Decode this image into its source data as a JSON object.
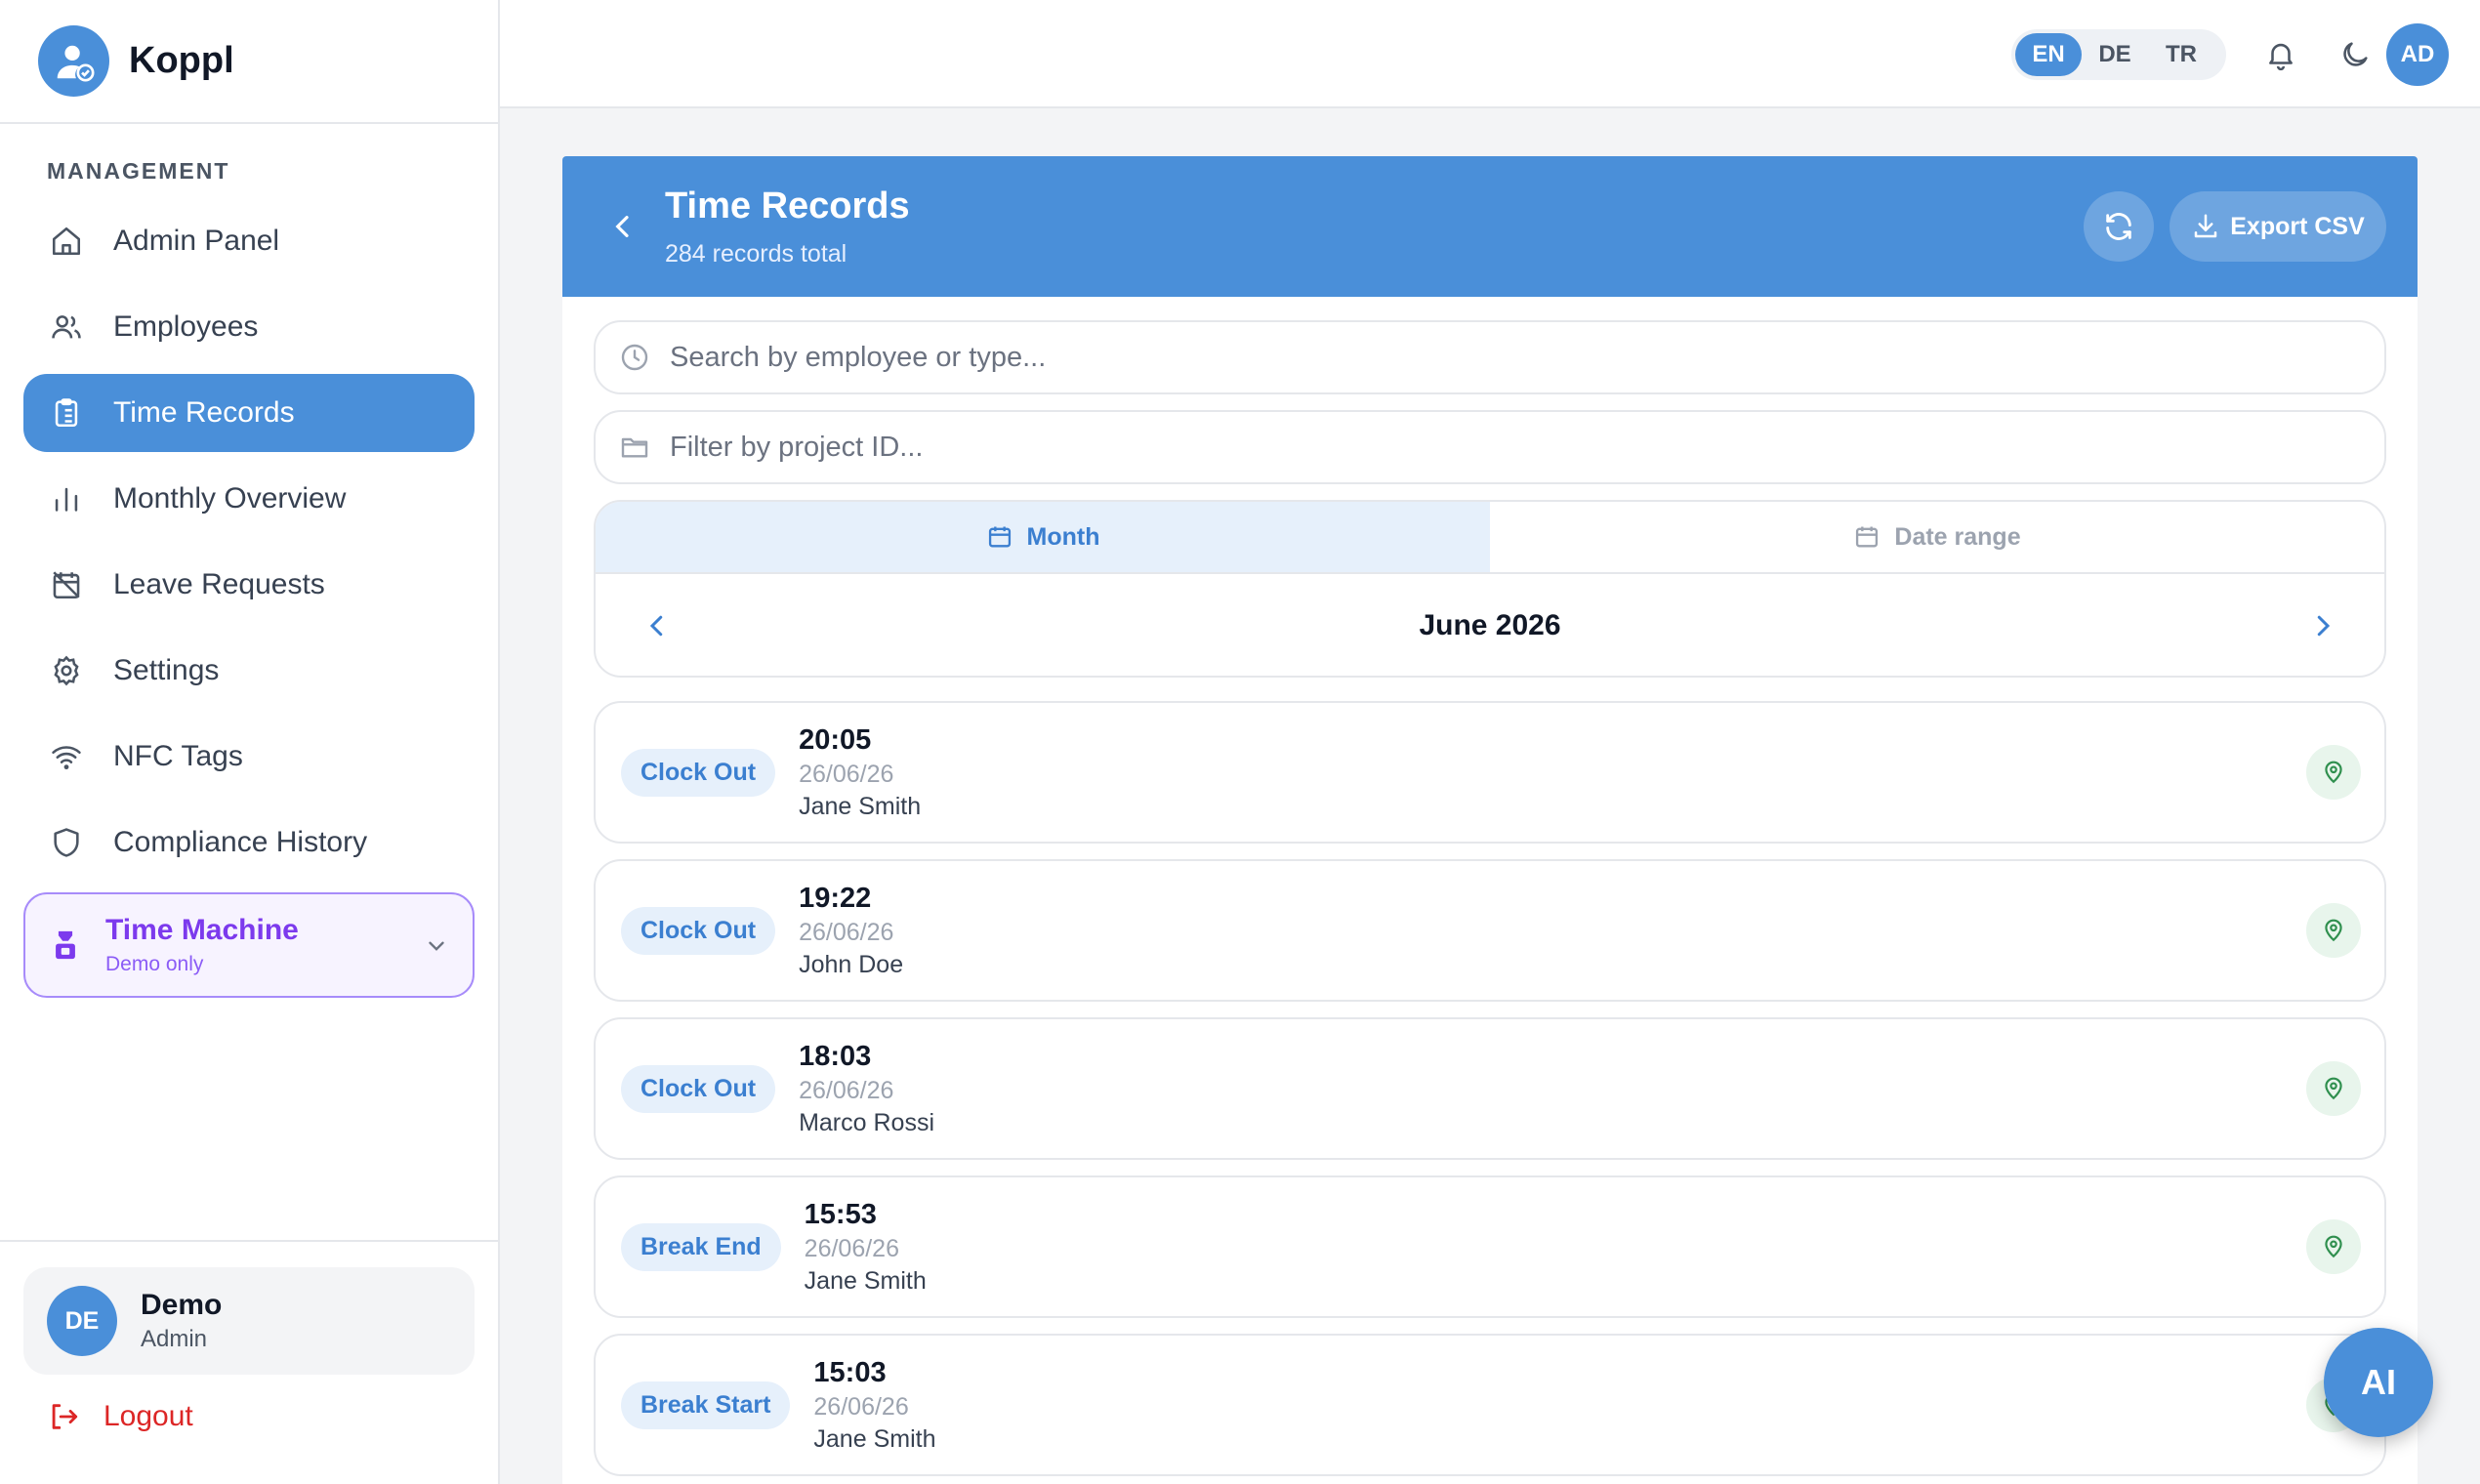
{
  "brand": {
    "name": "Koppl"
  },
  "sidebar": {
    "section_label": "MANAGEMENT",
    "items": [
      {
        "label": "Admin Panel",
        "icon": "home-icon"
      },
      {
        "label": "Employees",
        "icon": "users-icon"
      },
      {
        "label": "Time Records",
        "icon": "clipboard-icon",
        "active": true
      },
      {
        "label": "Monthly Overview",
        "icon": "bar-chart-icon"
      },
      {
        "label": "Leave Requests",
        "icon": "calendar-off-icon"
      },
      {
        "label": "Settings",
        "icon": "gear-icon"
      },
      {
        "label": "NFC Tags",
        "icon": "wifi-icon"
      },
      {
        "label": "Compliance History",
        "icon": "shield-icon"
      }
    ],
    "time_machine": {
      "title": "Time Machine",
      "subtitle": "Demo only"
    },
    "user": {
      "initials": "DE",
      "name": "Demo",
      "role": "Admin"
    },
    "logout_label": "Logout"
  },
  "topbar": {
    "languages": [
      "EN",
      "DE",
      "TR"
    ],
    "active_language": "EN",
    "avatar_initials": "AD"
  },
  "header": {
    "title": "Time Records",
    "subtitle": "284 records total",
    "export_label": "Export CSV"
  },
  "filters": {
    "search_placeholder": "Search by employee or type...",
    "project_placeholder": "Filter by project ID..."
  },
  "period": {
    "tabs": [
      "Month",
      "Date range"
    ],
    "active_tab": "Month",
    "current": "June 2026"
  },
  "records": [
    {
      "type": "Clock Out",
      "time": "20:05",
      "date": "26/06/26",
      "name": "Jane Smith"
    },
    {
      "type": "Clock Out",
      "time": "19:22",
      "date": "26/06/26",
      "name": "John Doe"
    },
    {
      "type": "Clock Out",
      "time": "18:03",
      "date": "26/06/26",
      "name": "Marco Rossi"
    },
    {
      "type": "Break End",
      "time": "15:53",
      "date": "26/06/26",
      "name": "Jane Smith"
    },
    {
      "type": "Break Start",
      "time": "15:03",
      "date": "26/06/26",
      "name": "Jane Smith"
    }
  ],
  "ai_button": {
    "label": "AI"
  },
  "colors": {
    "primary": "#4a8fd9",
    "accent_purple": "#7c3aed",
    "danger": "#dc2626",
    "location_green": "#2f8f4e"
  }
}
